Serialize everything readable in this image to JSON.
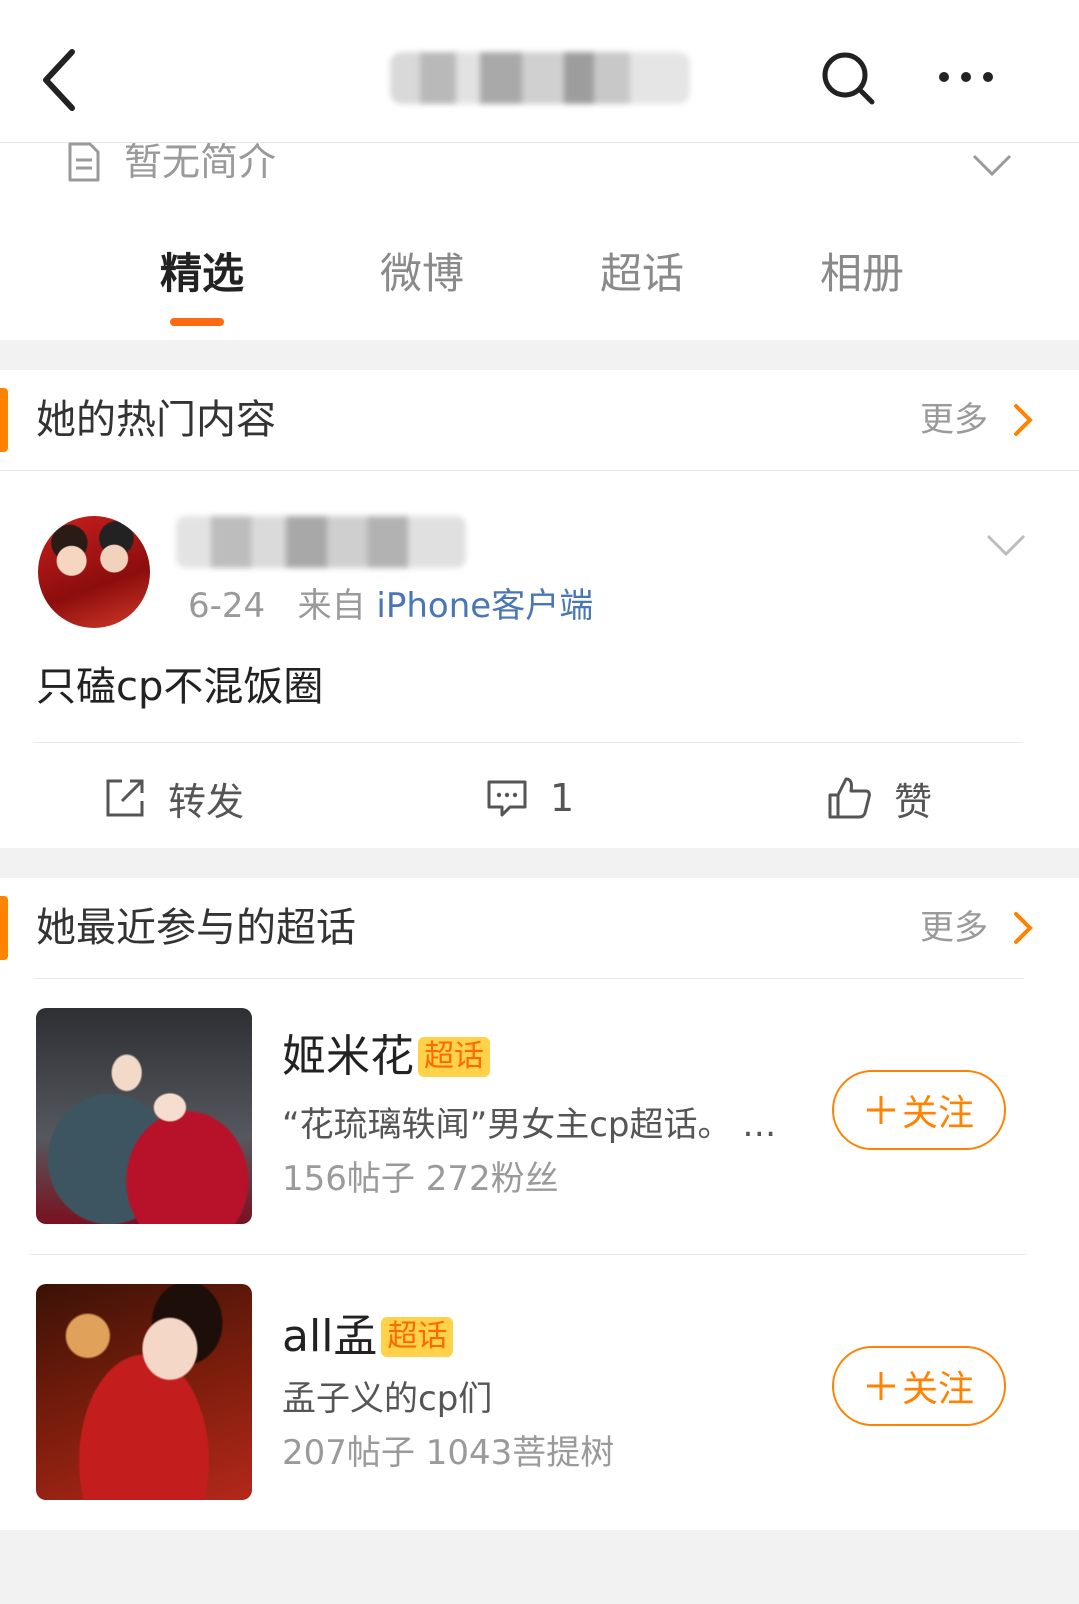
{
  "header": {
    "back_icon": "chevron-left-icon",
    "search_icon": "search-icon",
    "more_icon": "more-horizontal-icon"
  },
  "bio": {
    "text": "暂无简介"
  },
  "tabs": [
    {
      "label": "精选",
      "active": true
    },
    {
      "label": "微博",
      "active": false
    },
    {
      "label": "超话",
      "active": false
    },
    {
      "label": "相册",
      "active": false
    }
  ],
  "accent_color": "#ff8200",
  "hot_section": {
    "title": "她的热门内容",
    "more": "更多"
  },
  "post": {
    "date": "6-24",
    "source_prefix": "来自",
    "source": "iPhone客户端",
    "text": "只磕cp不混饭圈",
    "actions": {
      "repost": "转发",
      "comment_count": "1",
      "like": "赞"
    }
  },
  "topic_section": {
    "title": "她最近参与的超话",
    "more": "更多"
  },
  "topics": [
    {
      "name": "姬米花",
      "badge": "超话",
      "desc": "“花琉璃轶闻”男女主cp超话。 …",
      "stats": "156帖子 272粉丝",
      "follow": "关注"
    },
    {
      "name": "all孟",
      "badge": "超话",
      "desc": "孟子义的cp们",
      "stats": "207帖子 1043菩提树",
      "follow": "关注"
    }
  ]
}
